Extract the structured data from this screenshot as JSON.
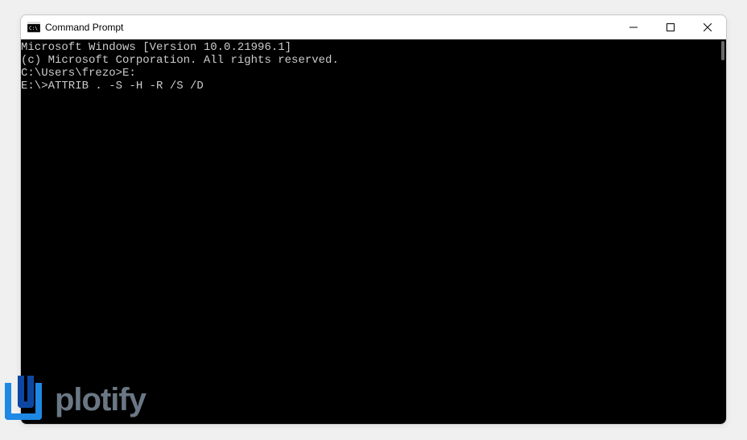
{
  "window": {
    "title": "Command Prompt"
  },
  "terminal": {
    "lines": [
      "Microsoft Windows [Version 10.0.21996.1]",
      "(c) Microsoft Corporation. All rights reserved.",
      "",
      "C:\\Users\\frezo>E:",
      "",
      "E:\\>ATTRIB . -S -H -R /S /D"
    ]
  },
  "watermark": {
    "text": "plotify"
  }
}
